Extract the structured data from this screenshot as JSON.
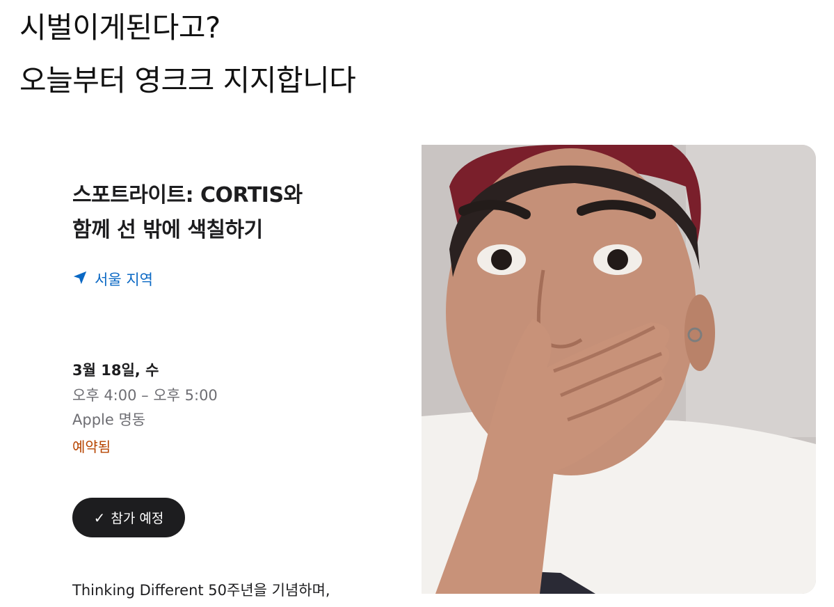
{
  "post": {
    "line1": "시벌이게된다고?",
    "line2": "오늘부터 영크크 지지합니다"
  },
  "event": {
    "title_line1": "스포트라이트: CORTIS와",
    "title_line2": "함께 선 밖에 색칠하기",
    "location": "서울 지역",
    "date": "3월 18일, 수",
    "time": "오후 4:00 – 오후 5:00",
    "place": "Apple 명동",
    "status": "예약됨",
    "attend_label": "참가 예정",
    "description": "Thinking Different 50주년을 기념하며,"
  },
  "colors": {
    "location_blue": "#0a68c4",
    "status_orange": "#b64400",
    "button_dark": "#1d1d1f"
  },
  "icons": {
    "location": "location-arrow-icon",
    "check": "checkmark-icon"
  }
}
